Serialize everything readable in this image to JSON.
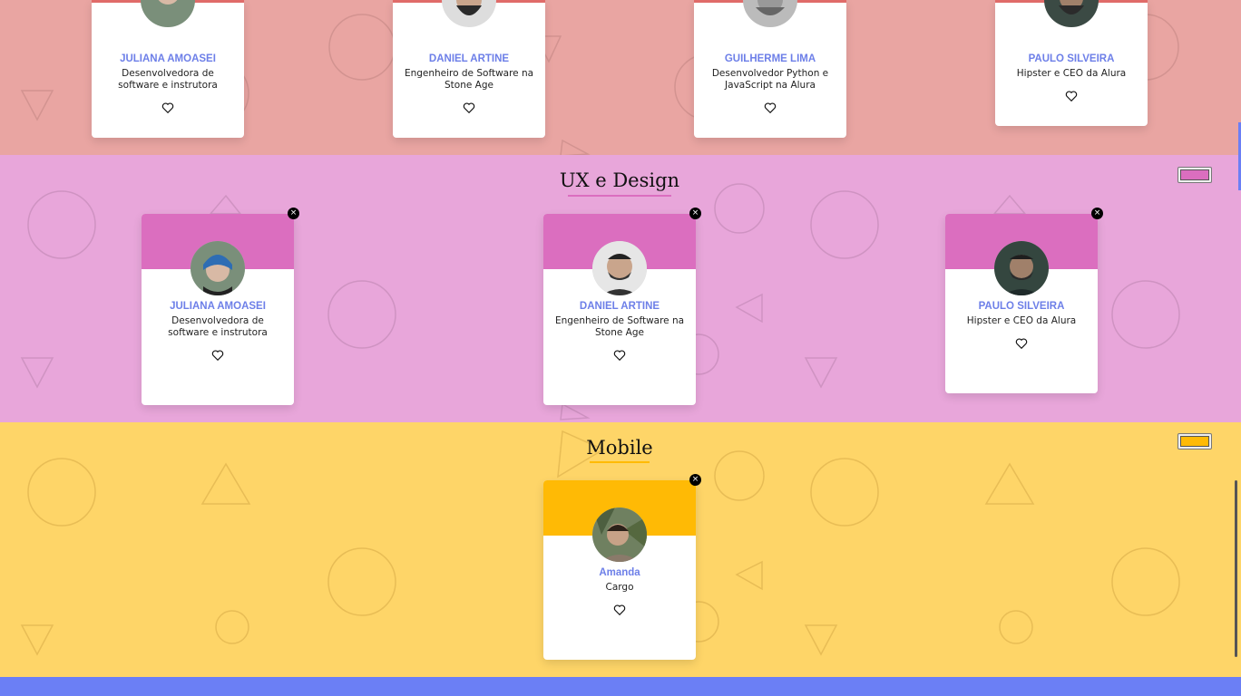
{
  "top_section": {
    "color": "#E9A5A2",
    "accent": "#E06B69",
    "cards": [
      {
        "name": "JULIANA AMOASEI",
        "role": "Desenvolvedora de software e instrutora"
      },
      {
        "name": "DANIEL ARTINE",
        "role": "Engenheiro de Software na Stone Age"
      },
      {
        "name": "GUILHERME LIMA",
        "role": "Desenvolvedor Python e JavaScript na Alura"
      },
      {
        "name": "PAULO SILVEIRA",
        "role": "Hipster e CEO da Alura"
      }
    ]
  },
  "ux_section": {
    "title": "UX e Design",
    "color": "#E8A6DA",
    "accent": "#DB6EBF",
    "cards": [
      {
        "name": "JULIANA AMOASEI",
        "role": "Desenvolvedora de software e instrutora"
      },
      {
        "name": "DANIEL ARTINE",
        "role": "Engenheiro de Software na Stone Age"
      },
      {
        "name": "PAULO SILVEIRA",
        "role": "Hipster e CEO da Alura"
      }
    ]
  },
  "mobile_section": {
    "title": "Mobile",
    "color": "#FED568",
    "accent": "#FFBA05",
    "cards": [
      {
        "name": "Amanda",
        "role": "Cargo"
      }
    ]
  },
  "icons": {
    "favorite": "heart-outline-icon",
    "close": "close-icon"
  },
  "close_label": "×",
  "footer_color": "#6B7FF5"
}
